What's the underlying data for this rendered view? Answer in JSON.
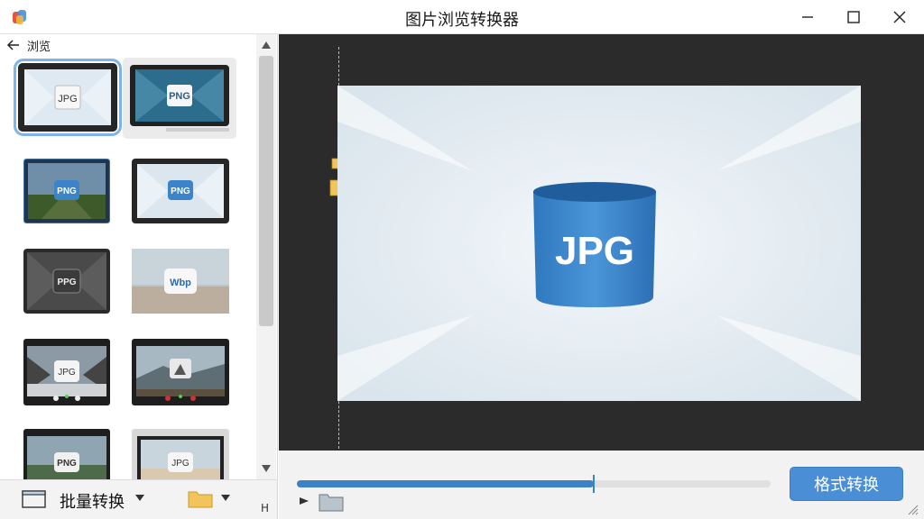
{
  "window": {
    "title": "图片浏览转换器",
    "controls": [
      "minimize",
      "maximize",
      "close"
    ]
  },
  "sidebar": {
    "back_label": "浏览",
    "thumbnails": [
      {
        "label": "JPG",
        "selected": true
      },
      {
        "label": "PNG",
        "selected": false
      },
      {
        "label": "PNG",
        "selected": false
      },
      {
        "label": "PNG",
        "selected": false
      },
      {
        "label": "PPG",
        "selected": false
      },
      {
        "label": "Wbp",
        "selected": false
      },
      {
        "label": "JPG",
        "selected": false
      },
      {
        "label": "",
        "selected": false
      },
      {
        "label": "PNG",
        "selected": false
      },
      {
        "label": "JPG",
        "selected": false
      }
    ],
    "bottom": {
      "batch_label": "批量转换",
      "corner_mark": "H"
    }
  },
  "viewer": {
    "preview_label": "JPG"
  },
  "controls": {
    "progress": 0.627,
    "convert_label": "格式转换"
  },
  "colors": {
    "accent": "#3b82c8",
    "button": "#4a8fd6",
    "viewer_bg": "#2b2b2b"
  }
}
